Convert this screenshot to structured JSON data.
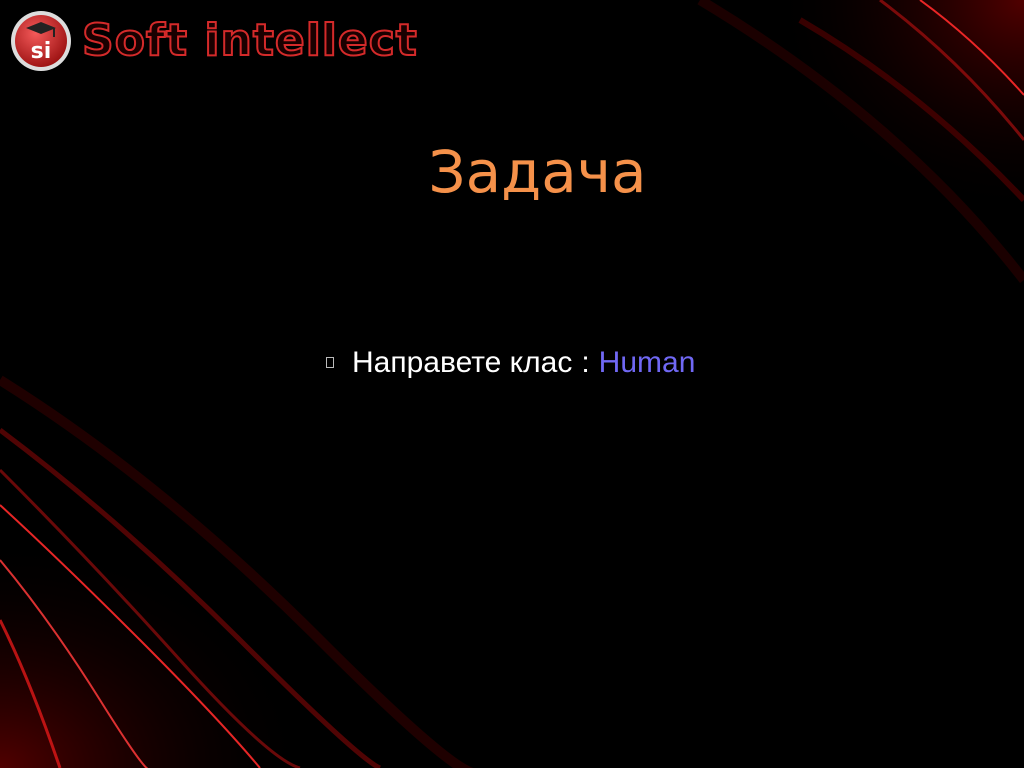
{
  "brand": {
    "logo_initials": "si",
    "logo_name": "Soft intellect"
  },
  "slide": {
    "title": "Задача",
    "bullets": [
      {
        "text": "Направете клас",
        "separator": ":",
        "highlight": "Human"
      }
    ]
  },
  "colors": {
    "background": "#000000",
    "title": "#f5914a",
    "bullet_text": "#ffffff",
    "highlight": "#7068f4",
    "brand_red": "#d42a2a"
  }
}
